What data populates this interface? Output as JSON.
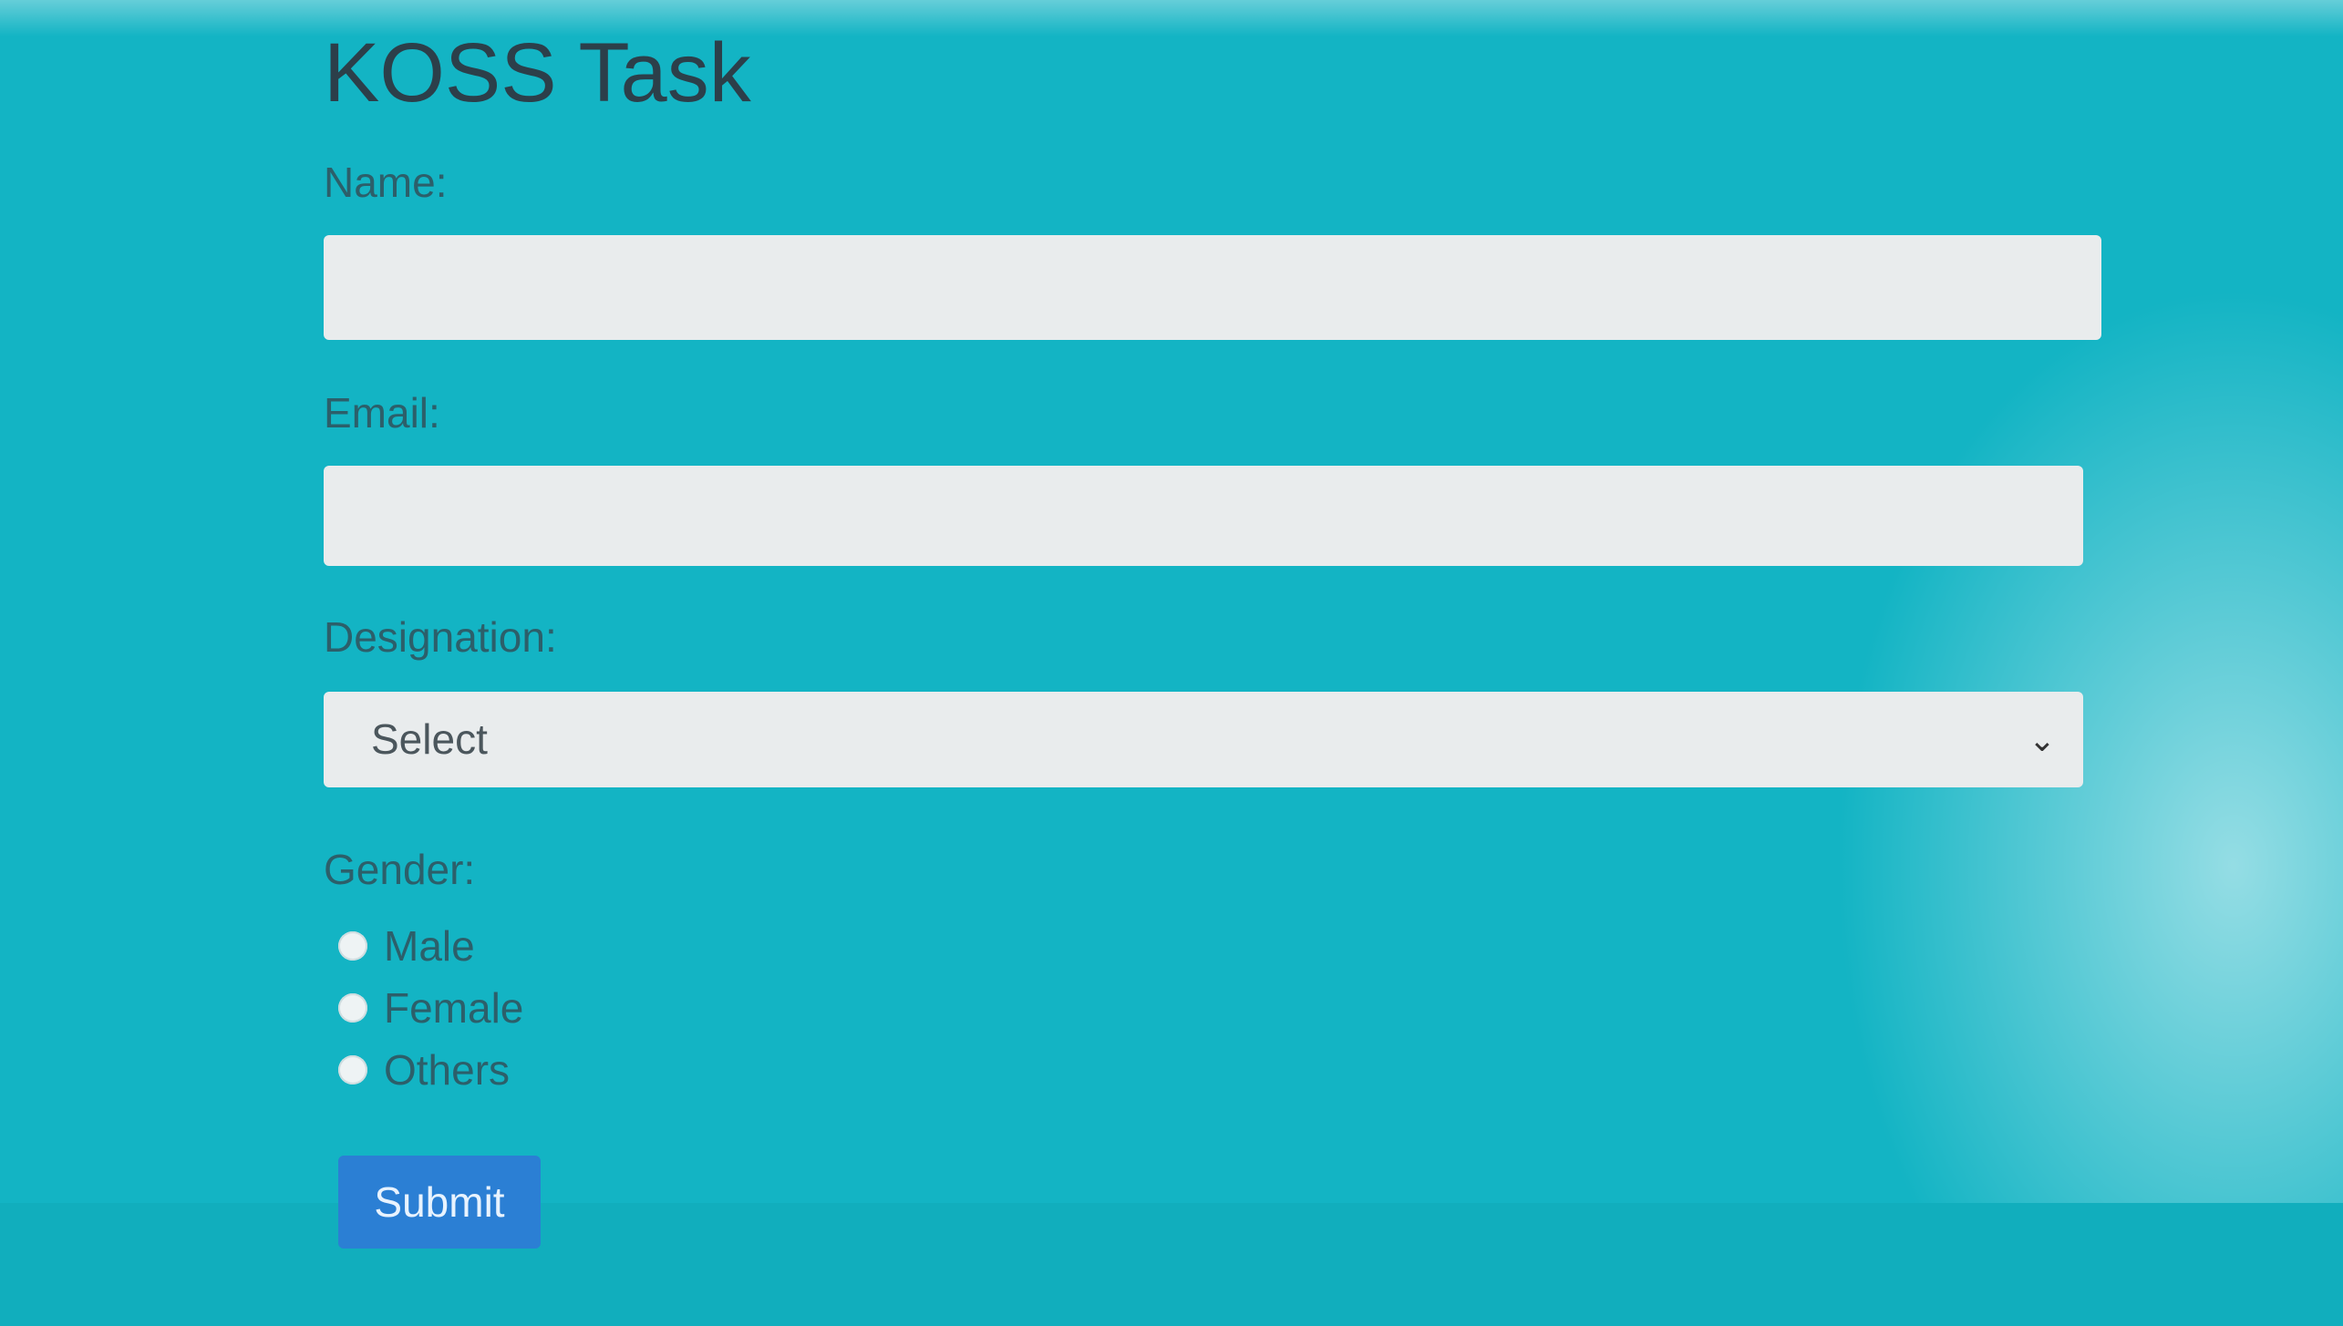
{
  "form": {
    "title": "KOSS Task",
    "name_label": "Name:",
    "name_value": "",
    "email_label": "Email:",
    "email_value": "",
    "designation_label": "Designation:",
    "designation_selected": "Select",
    "gender_label": "Gender:",
    "gender_options": [
      "Male",
      "Female",
      "Others"
    ],
    "submit_label": "Submit"
  },
  "colors": {
    "background": "#13b4c4",
    "input_bg": "#e9eced",
    "button_bg": "#2b7fd4"
  },
  "icons": {
    "select_arrow": "chevron-down-icon"
  }
}
